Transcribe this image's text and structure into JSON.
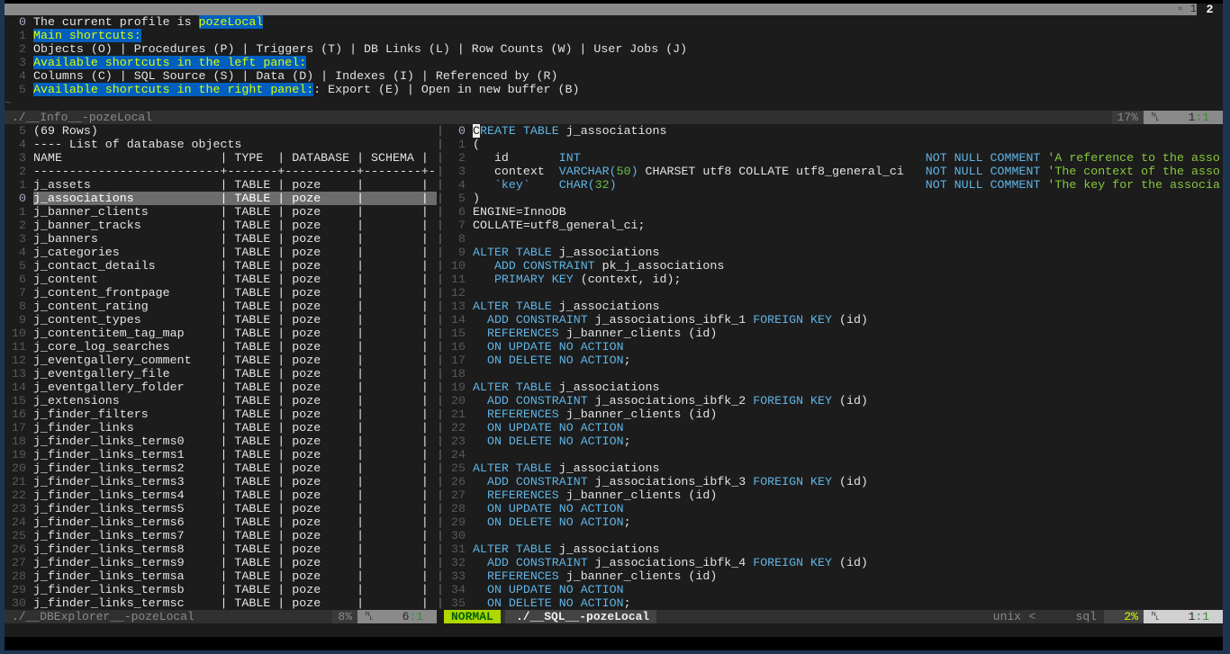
{
  "tabline": {
    "tab_icon": "▫",
    "tab1": "1",
    "tab2": "2"
  },
  "info": {
    "lines": [
      {
        "num": "0",
        "segs": [
          [
            "The current profile is ",
            ""
          ],
          [
            "pozeLocal",
            "hl"
          ]
        ]
      },
      {
        "num": "1",
        "segs": [
          [
            "Main shortcuts:",
            "hl"
          ]
        ]
      },
      {
        "num": "2",
        "segs": [
          [
            "Objects (O) | Procedures (P) | Triggers (T) | DB Links (L) | Row Counts (W) | User Jobs (J)",
            ""
          ]
        ]
      },
      {
        "num": "3",
        "segs": [
          [
            "Available shortcuts in the left panel:",
            "hl"
          ]
        ]
      },
      {
        "num": "4",
        "segs": [
          [
            "Columns (C) | SQL Source (S) | Data (D) | Indexes (I) | Referenced by (R)",
            ""
          ]
        ]
      },
      {
        "num": "5",
        "segs": [
          [
            "Available shortcuts in the right panel:",
            "hl"
          ],
          [
            ": Export (E) | Open in new buffer (B)",
            ""
          ]
        ]
      }
    ],
    "tilde": "~",
    "status": {
      "file": "./__Info__-pozeLocal",
      "percent": "17%",
      "ln_icon": "␤",
      "line": "1",
      "col": ":1"
    }
  },
  "left": {
    "header_lines": [
      {
        "num": "5",
        "text": "(69 Rows)"
      },
      {
        "num": "4",
        "text": "---- List of database objects"
      },
      {
        "num": "3",
        "text": "NAME                      | TYPE  | DATABASE | SCHEMA |"
      },
      {
        "num": "2",
        "text": "--------------------------+-------+----------+--------+-"
      }
    ],
    "type": "TABLE",
    "database": "poze",
    "schema": "",
    "selected_index": 1,
    "rows": [
      {
        "num": "1",
        "name": "j_assets"
      },
      {
        "num": "0",
        "name": "j_associations"
      },
      {
        "num": "1",
        "name": "j_banner_clients"
      },
      {
        "num": "2",
        "name": "j_banner_tracks"
      },
      {
        "num": "3",
        "name": "j_banners"
      },
      {
        "num": "4",
        "name": "j_categories"
      },
      {
        "num": "5",
        "name": "j_contact_details"
      },
      {
        "num": "6",
        "name": "j_content"
      },
      {
        "num": "7",
        "name": "j_content_frontpage"
      },
      {
        "num": "8",
        "name": "j_content_rating"
      },
      {
        "num": "9",
        "name": "j_content_types"
      },
      {
        "num": "10",
        "name": "j_contentitem_tag_map"
      },
      {
        "num": "11",
        "name": "j_core_log_searches"
      },
      {
        "num": "12",
        "name": "j_eventgallery_comment"
      },
      {
        "num": "13",
        "name": "j_eventgallery_file"
      },
      {
        "num": "14",
        "name": "j_eventgallery_folder"
      },
      {
        "num": "15",
        "name": "j_extensions"
      },
      {
        "num": "16",
        "name": "j_finder_filters"
      },
      {
        "num": "17",
        "name": "j_finder_links"
      },
      {
        "num": "18",
        "name": "j_finder_links_terms0"
      },
      {
        "num": "19",
        "name": "j_finder_links_terms1"
      },
      {
        "num": "20",
        "name": "j_finder_links_terms2"
      },
      {
        "num": "21",
        "name": "j_finder_links_terms3"
      },
      {
        "num": "22",
        "name": "j_finder_links_terms4"
      },
      {
        "num": "23",
        "name": "j_finder_links_terms5"
      },
      {
        "num": "24",
        "name": "j_finder_links_terms6"
      },
      {
        "num": "25",
        "name": "j_finder_links_terms7"
      },
      {
        "num": "26",
        "name": "j_finder_links_terms8"
      },
      {
        "num": "27",
        "name": "j_finder_links_terms9"
      },
      {
        "num": "28",
        "name": "j_finder_links_termsa"
      },
      {
        "num": "29",
        "name": "j_finder_links_termsb"
      },
      {
        "num": "30",
        "name": "j_finder_links_termsc"
      }
    ],
    "status": {
      "file": "./__DBExplorer__-pozeLocal",
      "percent": "8%",
      "ln_icon": "␤",
      "line": "6",
      "col": ":1"
    }
  },
  "right": {
    "lines": [
      [
        [
          "C",
          "cursor"
        ],
        [
          "REATE TABLE",
          "k"
        ],
        [
          " j_associations",
          ""
        ]
      ],
      [
        [
          "(",
          ""
        ]
      ],
      [
        [
          "   id       ",
          ""
        ],
        [
          "INT",
          "k"
        ],
        [
          "                                                ",
          ""
        ],
        [
          "NOT NULL COMMENT",
          "k"
        ],
        [
          " 'A reference to the asso",
          "s"
        ]
      ],
      [
        [
          "   context  ",
          ""
        ],
        [
          "VARCHAR(",
          "k"
        ],
        [
          "50",
          "n"
        ],
        [
          ")",
          "k"
        ],
        [
          " CHARSET utf8 COLLATE utf8_general_ci   ",
          ""
        ],
        [
          "NOT NULL COMMENT",
          "k"
        ],
        [
          " 'The context of the asso",
          "s"
        ]
      ],
      [
        [
          "   ",
          ""
        ],
        [
          "`key`",
          "k"
        ],
        [
          "    ",
          ""
        ],
        [
          "CHAR(",
          "k"
        ],
        [
          "32",
          "n"
        ],
        [
          ")",
          "k"
        ],
        [
          "                                           ",
          ""
        ],
        [
          "NOT NULL COMMENT",
          "k"
        ],
        [
          " 'The key for the associa",
          "s"
        ]
      ],
      [
        [
          ")",
          ""
        ]
      ],
      [
        [
          "ENGINE=InnoDB",
          ""
        ]
      ],
      [
        [
          "COLLATE=utf8_general_ci;",
          ""
        ]
      ],
      [],
      [
        [
          "ALTER TABLE",
          "k"
        ],
        [
          " j_associations",
          ""
        ]
      ],
      [
        [
          "   ",
          ""
        ],
        [
          "ADD CONSTRAINT",
          "k"
        ],
        [
          " pk_j_associations",
          ""
        ]
      ],
      [
        [
          "   ",
          ""
        ],
        [
          "PRIMARY KEY",
          "k"
        ],
        [
          " (context, id);",
          ""
        ]
      ],
      [],
      [
        [
          "ALTER TABLE",
          "k"
        ],
        [
          " j_associations",
          ""
        ]
      ],
      [
        [
          "  ",
          ""
        ],
        [
          "ADD CONSTRAINT",
          "k"
        ],
        [
          " j_associations_ibfk_1 ",
          ""
        ],
        [
          "FOREIGN KEY",
          "k"
        ],
        [
          " (id)",
          ""
        ]
      ],
      [
        [
          "  ",
          ""
        ],
        [
          "REFERENCES",
          "k"
        ],
        [
          " j_banner_clients (id)",
          ""
        ]
      ],
      [
        [
          "  ",
          ""
        ],
        [
          "ON UPDATE NO ACTION",
          "k"
        ]
      ],
      [
        [
          "  ",
          ""
        ],
        [
          "ON DELETE NO ACTION",
          "k"
        ],
        [
          ";",
          ""
        ]
      ],
      [],
      [
        [
          "ALTER TABLE",
          "k"
        ],
        [
          " j_associations",
          ""
        ]
      ],
      [
        [
          "  ",
          ""
        ],
        [
          "ADD CONSTRAINT",
          "k"
        ],
        [
          " j_associations_ibfk_2 ",
          ""
        ],
        [
          "FOREIGN KEY",
          "k"
        ],
        [
          " (id)",
          ""
        ]
      ],
      [
        [
          "  ",
          ""
        ],
        [
          "REFERENCES",
          "k"
        ],
        [
          " j_banner_clients (id)",
          ""
        ]
      ],
      [
        [
          "  ",
          ""
        ],
        [
          "ON UPDATE NO ACTION",
          "k"
        ]
      ],
      [
        [
          "  ",
          ""
        ],
        [
          "ON DELETE NO ACTION",
          "k"
        ],
        [
          ";",
          ""
        ]
      ],
      [],
      [
        [
          "ALTER TABLE",
          "k"
        ],
        [
          " j_associations",
          ""
        ]
      ],
      [
        [
          "  ",
          ""
        ],
        [
          "ADD CONSTRAINT",
          "k"
        ],
        [
          " j_associations_ibfk_3 ",
          ""
        ],
        [
          "FOREIGN KEY",
          "k"
        ],
        [
          " (id)",
          ""
        ]
      ],
      [
        [
          "  ",
          ""
        ],
        [
          "REFERENCES",
          "k"
        ],
        [
          " j_banner_clients (id)",
          ""
        ]
      ],
      [
        [
          "  ",
          ""
        ],
        [
          "ON UPDATE NO ACTION",
          "k"
        ]
      ],
      [
        [
          "  ",
          ""
        ],
        [
          "ON DELETE NO ACTION",
          "k"
        ],
        [
          ";",
          ""
        ]
      ],
      [],
      [
        [
          "ALTER TABLE",
          "k"
        ],
        [
          " j_associations",
          ""
        ]
      ],
      [
        [
          "  ",
          ""
        ],
        [
          "ADD CONSTRAINT",
          "k"
        ],
        [
          " j_associations_ibfk_4 ",
          ""
        ],
        [
          "FOREIGN KEY",
          "k"
        ],
        [
          " (id)",
          ""
        ]
      ],
      [
        [
          "  ",
          ""
        ],
        [
          "REFERENCES",
          "k"
        ],
        [
          " j_banner_clients (id)",
          ""
        ]
      ],
      [
        [
          "  ",
          ""
        ],
        [
          "ON UPDATE NO ACTION",
          "k"
        ]
      ],
      [
        [
          "  ",
          ""
        ],
        [
          "ON DELETE NO ACTION",
          "k"
        ],
        [
          ";",
          ""
        ]
      ]
    ],
    "status": {
      "mode": "NORMAL",
      "file": "./__SQL__-pozeLocal",
      "fileformat": "unix",
      "filetype": "sql",
      "percent": "2%",
      "ln_icon": "␤",
      "line": "1",
      "col": ":1"
    }
  },
  "colors": {
    "keyword": "#5fb4e6",
    "string": "#87c83c",
    "number": "#6cc04a",
    "highlight_bg": "#005fbf",
    "highlight_fg": "#d7ff00",
    "mode_bg": "#afd700"
  }
}
